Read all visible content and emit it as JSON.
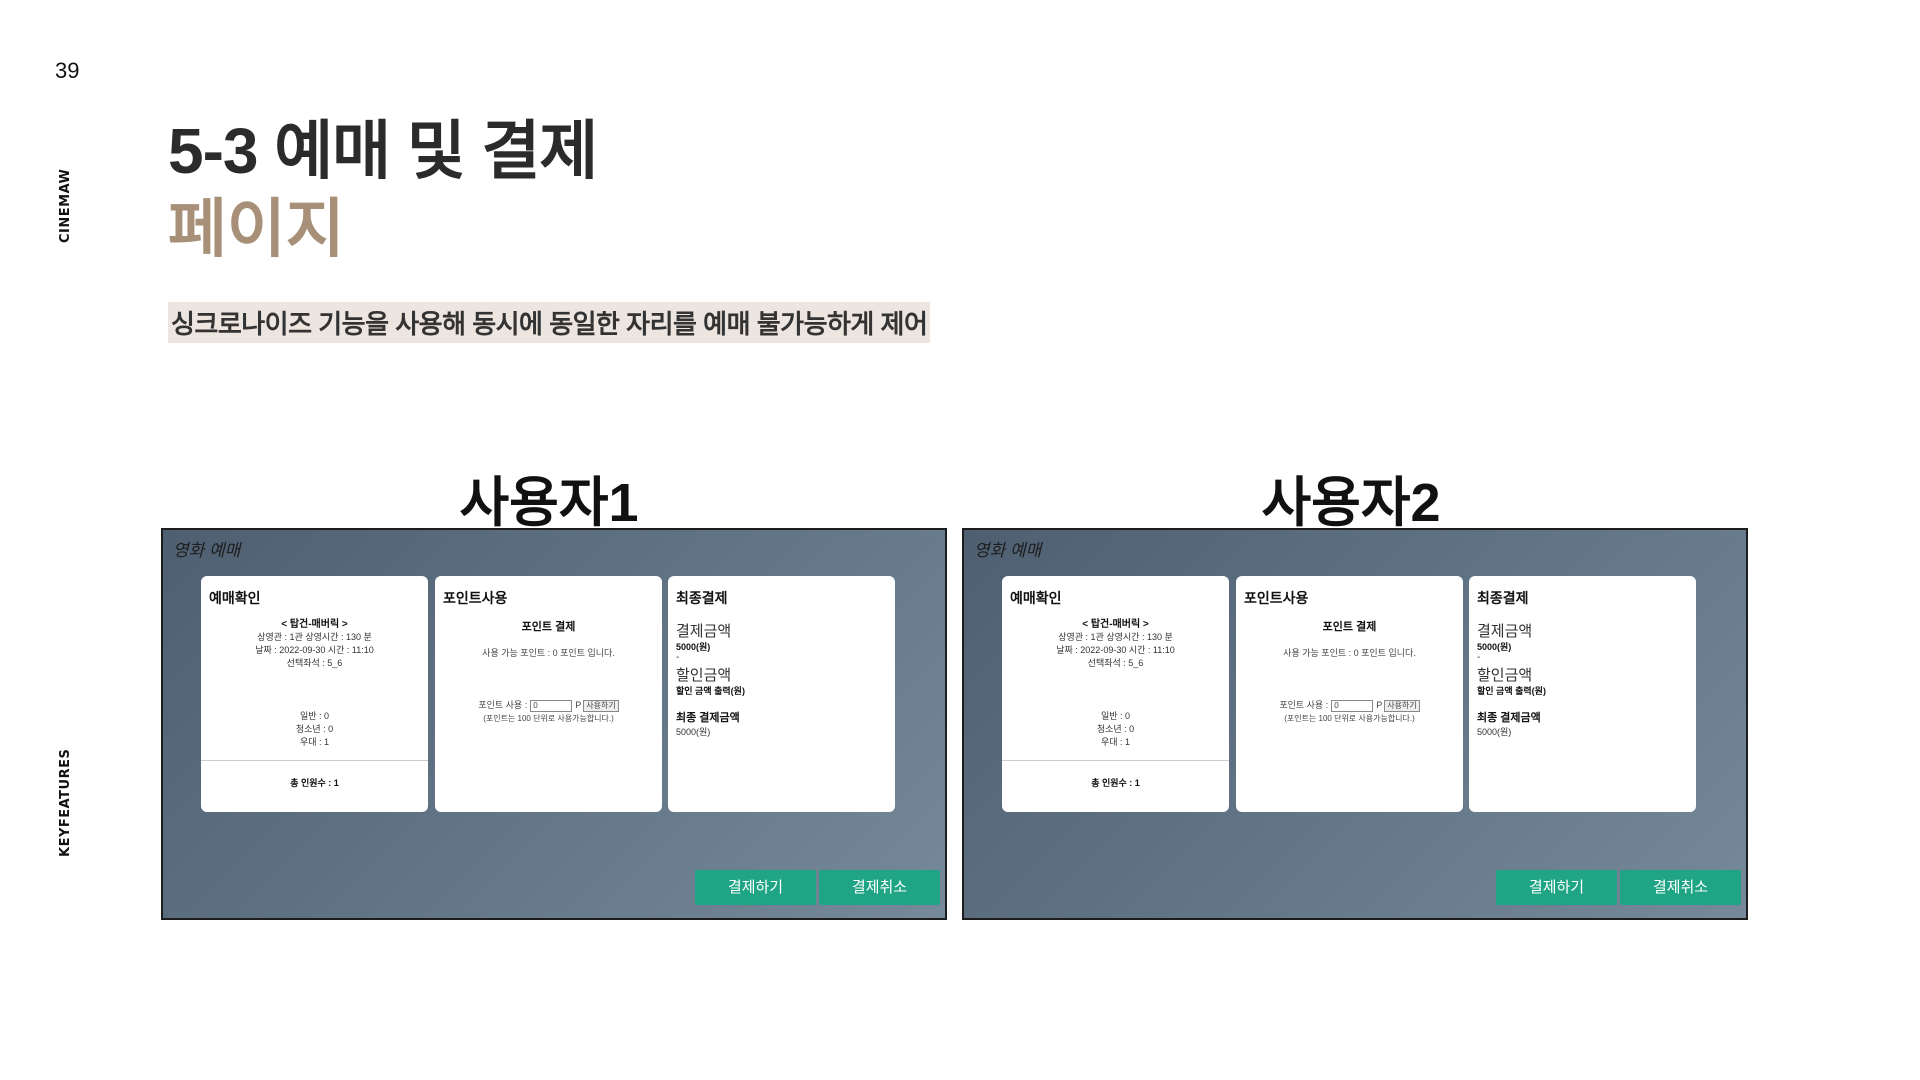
{
  "slide": {
    "page_number": "39",
    "brand": "CINEMAW",
    "section": "KEYFEATURES",
    "title": "5-3 예매 및 결제",
    "subtitle": "페이지",
    "description": "싱크로나이즈 기능을 사용해 동시에 동일한 자리를 예매 불가능하게 제어"
  },
  "screens": [
    {
      "user_label": "사용자1",
      "window_title": "영화 예매",
      "booking": {
        "header": "예매확인",
        "movie": "< 탑건-매버릭 >",
        "info_line1": "상영관 : 1관   상영시간 : 130 분",
        "info_line2": "날짜 : 2022-09-30   시간 : 11:10",
        "seat": "선택좌석 : 5_6",
        "general": "일반 : 0",
        "youth": "청소년 : 0",
        "preferential": "우대 : 1",
        "total": "총 인원수 : 1"
      },
      "points": {
        "header": "포인트사용",
        "title": "포인트 결제",
        "available": "사용 가능 포인트 : 0 포인트 입니다.",
        "use_label": "포인트 사용 :",
        "input_value": "0",
        "unit": "P",
        "use_button": "사용하기",
        "note": "(포인트는 100 단위로 사용가능합니다.)"
      },
      "final": {
        "header": "최종결제",
        "amount_label": "결제금액",
        "amount_value": "5000(원)",
        "dash": "-",
        "discount_label": "할인금액",
        "discount_value": "할인 금액 출력(원)",
        "final_label": "최종 결제금액",
        "final_value": "5000(원)"
      },
      "pay_button": "결제하기",
      "cancel_button": "결제취소"
    },
    {
      "user_label": "사용자2",
      "window_title": "영화 예매",
      "booking": {
        "header": "예매확인",
        "movie": "< 탑건-매버릭 >",
        "info_line1": "상영관 : 1관   상영시간 : 130 분",
        "info_line2": "날짜 : 2022-09-30   시간 : 11:10",
        "seat": "선택좌석 : 5_6",
        "general": "일반 : 0",
        "youth": "청소년 : 0",
        "preferential": "우대 : 1",
        "total": "총 인원수 : 1"
      },
      "points": {
        "header": "포인트사용",
        "title": "포인트 결제",
        "available": "사용 가능 포인트 : 0 포인트 입니다.",
        "use_label": "포인트 사용 :",
        "input_value": "0",
        "unit": "P",
        "use_button": "사용하기",
        "note": "(포인트는 100 단위로 사용가능합니다.)"
      },
      "final": {
        "header": "최종결제",
        "amount_label": "결제금액",
        "amount_value": "5000(원)",
        "dash": "-",
        "discount_label": "할인금액",
        "discount_value": "할인 금액 출력(원)",
        "final_label": "최종 결제금액",
        "final_value": "5000(원)"
      },
      "pay_button": "결제하기",
      "cancel_button": "결제취소"
    }
  ],
  "colors": {
    "accent_button": "#1fa585",
    "subtitle": "#a89078",
    "highlight": "#ede5df"
  }
}
